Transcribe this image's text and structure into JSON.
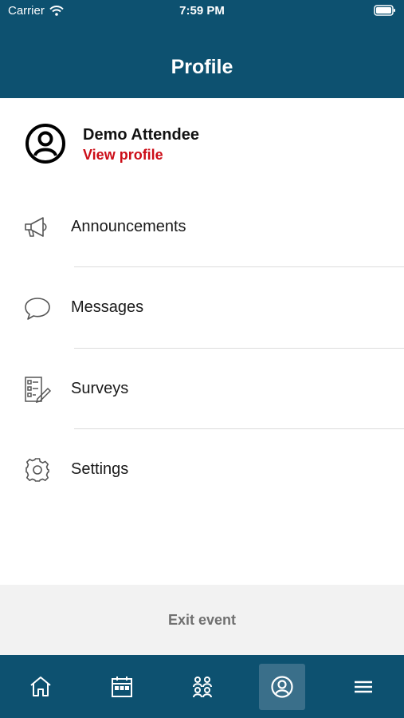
{
  "status_bar": {
    "carrier": "Carrier",
    "time": "7:59 PM"
  },
  "header": {
    "title": "Profile"
  },
  "profile": {
    "name": "Demo Attendee",
    "link": "View profile"
  },
  "menu": [
    {
      "label": "Announcements",
      "icon": "megaphone-icon"
    },
    {
      "label": "Messages",
      "icon": "chat-bubble-icon"
    },
    {
      "label": "Surveys",
      "icon": "survey-checklist-icon"
    },
    {
      "label": "Settings",
      "icon": "gear-icon"
    }
  ],
  "exit": {
    "label": "Exit event"
  },
  "tabbar": {
    "tabs": [
      {
        "icon": "home-icon"
      },
      {
        "icon": "calendar-icon"
      },
      {
        "icon": "attendees-icon"
      },
      {
        "icon": "profile-icon",
        "active": true
      },
      {
        "icon": "hamburger-menu-icon"
      }
    ]
  },
  "colors": {
    "header_bg": "#0d5170",
    "accent_red": "#cc0e18",
    "exit_bg": "#f2f2f2"
  }
}
